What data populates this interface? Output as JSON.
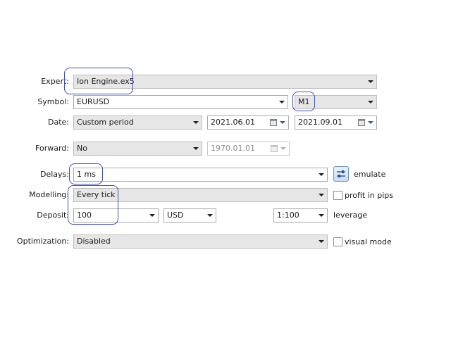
{
  "expert": {
    "label": "Expert:",
    "value": "Ion Engine.ex5"
  },
  "symbol": {
    "label": "Symbol:",
    "value": "EURUSD",
    "timeframe": "M1"
  },
  "date": {
    "label": "Date:",
    "period": "Custom period",
    "from": "2021.06.01",
    "to": "2021.09.01"
  },
  "forward": {
    "label": "Forward:",
    "value": "No",
    "date": "1970.01.01"
  },
  "delays": {
    "label": "Delays:",
    "value": "1 ms",
    "emulate_label": "emulate"
  },
  "modelling": {
    "label": "Modelling:",
    "value": "Every tick",
    "profit_in_pips_label": "profit in pips",
    "profit_in_pips_checked": false
  },
  "deposit": {
    "label": "Deposit:",
    "amount": "100",
    "currency": "USD",
    "leverage": "1:100",
    "leverage_label": "leverage"
  },
  "optimization": {
    "label": "Optimization:",
    "value": "Disabled",
    "visual_mode_label": "visual mode",
    "visual_mode_checked": false
  },
  "colors": {
    "highlight": "#3d4ec6",
    "field_border": "#a9a9a9",
    "disabled_field": "#e6e6e6"
  },
  "icons": {
    "settings_button": "sliders-icon",
    "calendar": "calendar-icon"
  }
}
